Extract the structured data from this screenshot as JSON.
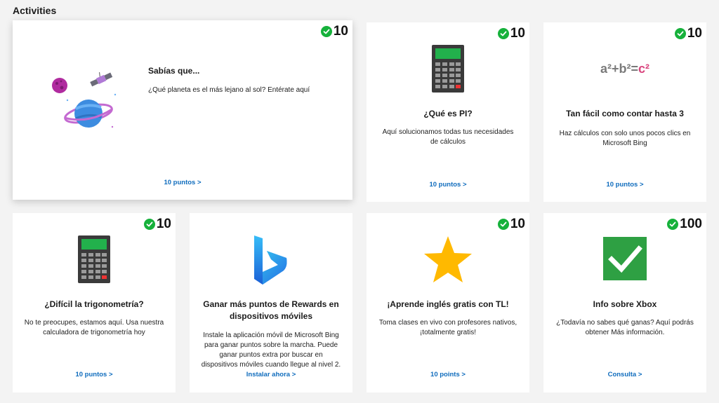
{
  "section": {
    "title": "Activities"
  },
  "cards": [
    {
      "points_badge": "10",
      "illustration": "planet-satellite-illustration",
      "title": "Sabías que...",
      "description": "¿Qué planeta es el más lejano al sol? Entérate aquí",
      "link": "10 puntos >"
    },
    {
      "points_badge": "10",
      "illustration": "calculator-illustration",
      "title": "¿Qué es PI?",
      "description": "Aquí solucionamos todas tus necesidades de cálculos",
      "link": "10 puntos >"
    },
    {
      "points_badge": "10",
      "illustration": "formula-illustration",
      "formula_text": "a²+b²=",
      "formula_highlight": "c²",
      "title": "Tan fácil como contar hasta 3",
      "description": "Haz cálculos con solo unos pocos clics en Microsoft Bing",
      "link": "10 puntos >"
    },
    {
      "points_badge": "10",
      "illustration": "calculator-illustration",
      "title": "¿Difícil la trigonometría?",
      "description": "No te preocupes, estamos aquí. Usa nuestra calculadora de trigonometría hoy",
      "link": "10 puntos >"
    },
    {
      "illustration": "bing-logo",
      "title": "Ganar más puntos de Rewards en dispositivos móviles",
      "description": "Instale la aplicación móvil de Microsoft Bing para ganar puntos sobre la marcha. Puede ganar puntos extra por buscar en dispositivos móviles cuando llegue al nivel 2.",
      "link": "Instalar ahora >"
    },
    {
      "points_badge": "10",
      "illustration": "star-icon",
      "title": "¡Aprende inglés gratis con TL!",
      "description": "Toma clases en vivo con profesores nativos, ¡totalmente gratis!",
      "link": "10 points >"
    },
    {
      "points_badge": "100",
      "illustration": "green-checkbox-icon",
      "title": "Info sobre Xbox",
      "description": "¿Todavía no sabes qué ganas? Aquí podrás obtener Más información.",
      "link": "Consulta >"
    }
  ],
  "colors": {
    "badge_check": "#16b13b",
    "link": "#0f6cbd",
    "star": "#ffb900",
    "checkbox": "#2ea043",
    "formula_highlight": "#d9457e"
  }
}
